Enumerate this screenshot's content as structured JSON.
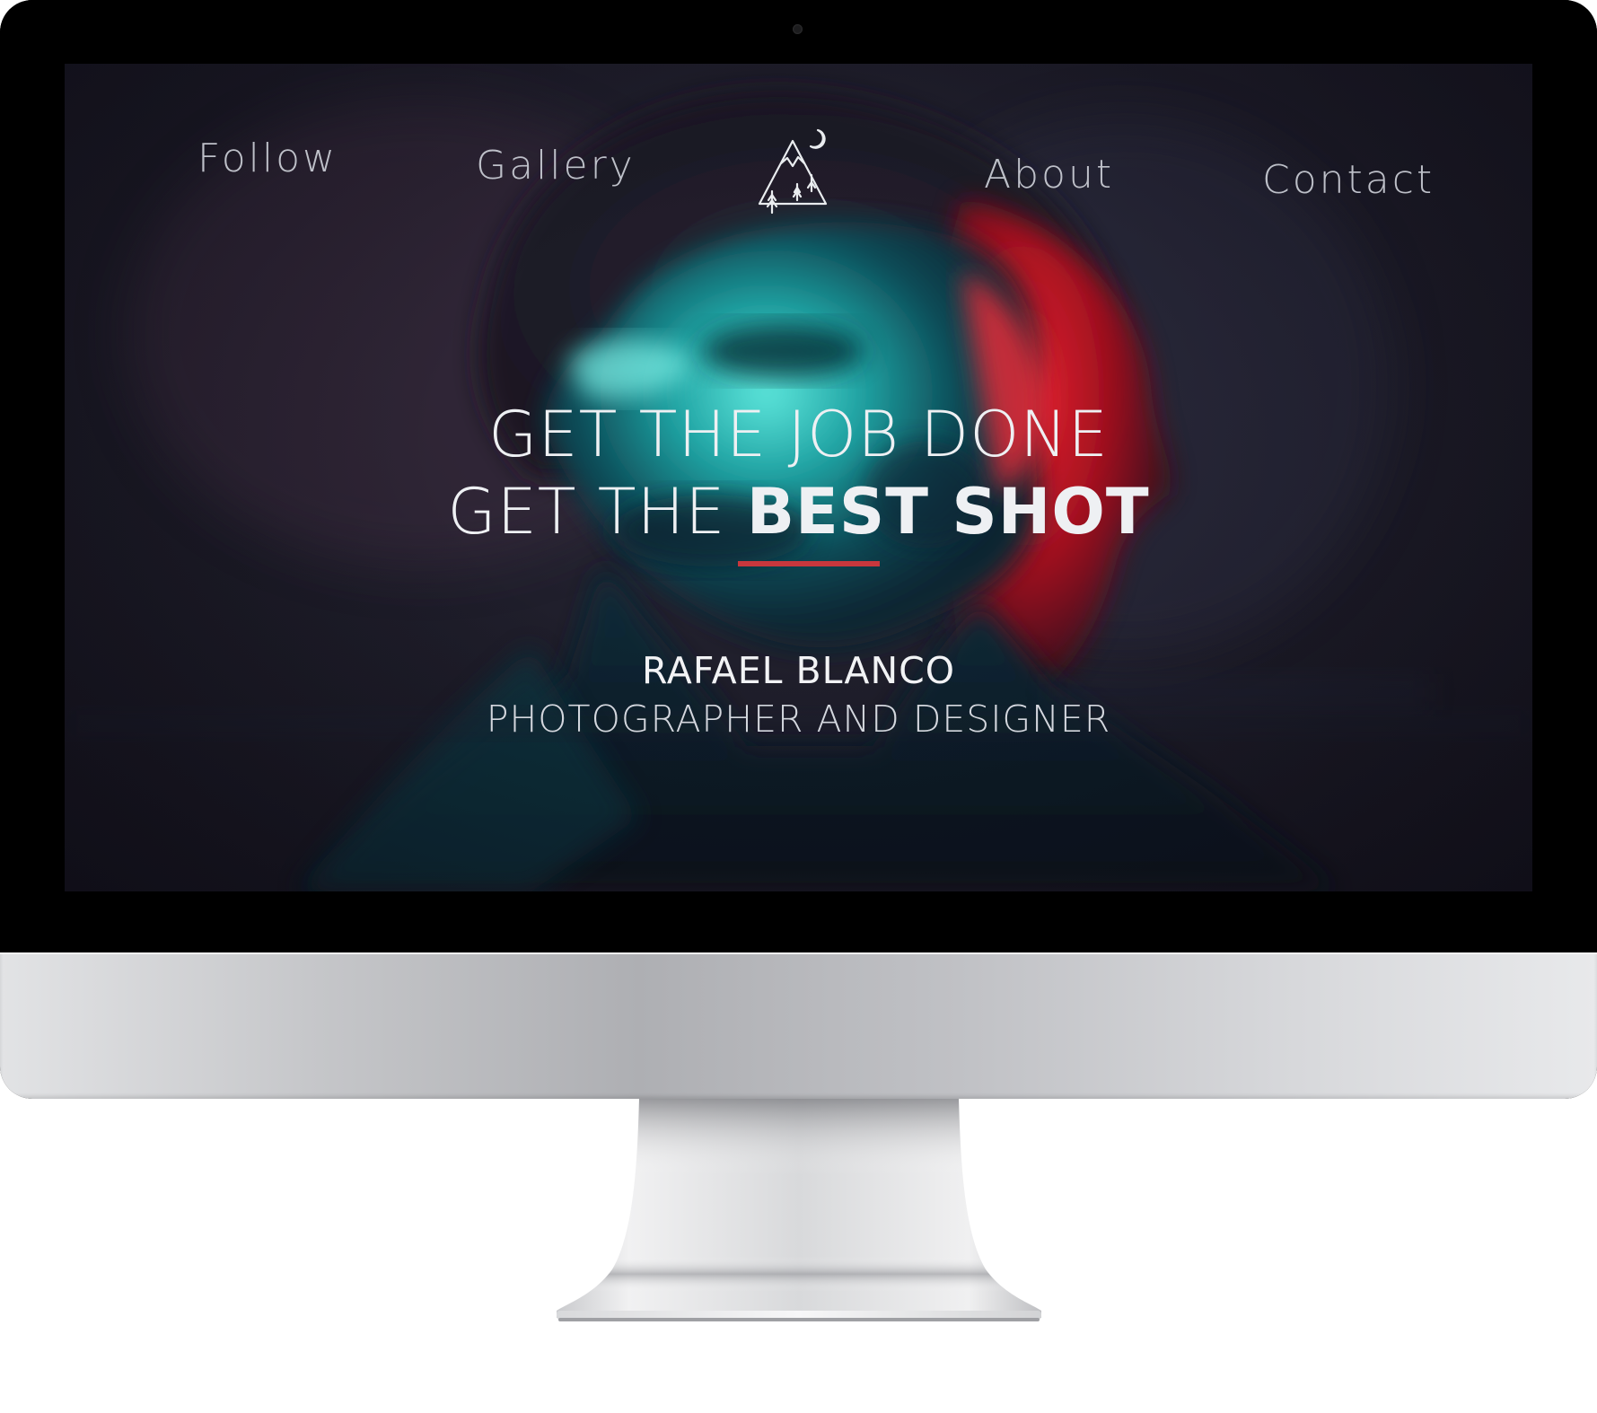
{
  "nav": {
    "follow": "Follow",
    "gallery": "Gallery",
    "about": "About",
    "contact": "Contact",
    "logo_icon": "mountain-moon-icon"
  },
  "hero": {
    "line1": "GET THE JOB DONE",
    "line2_prefix": "GET THE ",
    "line2_emphasis": "BEST SHOT",
    "accent_color": "#c8373d"
  },
  "profile": {
    "name": "RAFAEL BLANCO",
    "role": "PHOTOGRAPHER AND DESIGNER"
  },
  "colors": {
    "teal_light": "#2fd6d0",
    "red_light": "#e8192c",
    "background": "#1f1e2a"
  }
}
